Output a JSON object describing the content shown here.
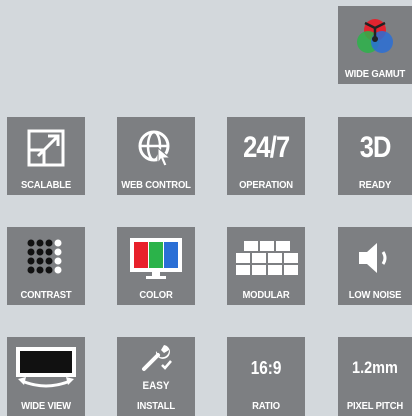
{
  "tiles": {
    "wide_gamut": {
      "label": "WIDE GAMUT",
      "icon": "rgb-venn-icon"
    },
    "scalable": {
      "label": "SCALABLE",
      "icon": "expand-arrow-icon"
    },
    "web_control": {
      "label": "WEB CONTROL",
      "icon": "globe-cursor-icon"
    },
    "operation": {
      "label": "OPERATION",
      "glyph": "24/7"
    },
    "ready": {
      "label": "READY",
      "glyph": "3D"
    },
    "contrast": {
      "label": "CONTRAST",
      "icon": "dot-grid-icon"
    },
    "color": {
      "label": "COLOR",
      "icon": "rgb-monitor-icon"
    },
    "modular": {
      "label": "MODULAR",
      "icon": "panel-grid-icon"
    },
    "low_noise": {
      "label": "LOW NOISE",
      "icon": "speaker-icon"
    },
    "wide_view": {
      "label": "WIDE VIEW",
      "icon": "wide-view-monitor-icon"
    },
    "easy_install": {
      "label": "INSTALL",
      "sub_label": "EASY",
      "icon": "wrench-check-icon"
    },
    "ratio": {
      "label": "RATIO",
      "glyph": "16:9"
    },
    "pixel_pitch": {
      "label": "PIXEL PITCH",
      "glyph": "1.2mm"
    }
  },
  "colors": {
    "tile_bg": "#7d7f82",
    "page_bg": "#d3d8dc",
    "red": "#e8202a",
    "green": "#2bb34a",
    "blue": "#2a6fd6"
  }
}
